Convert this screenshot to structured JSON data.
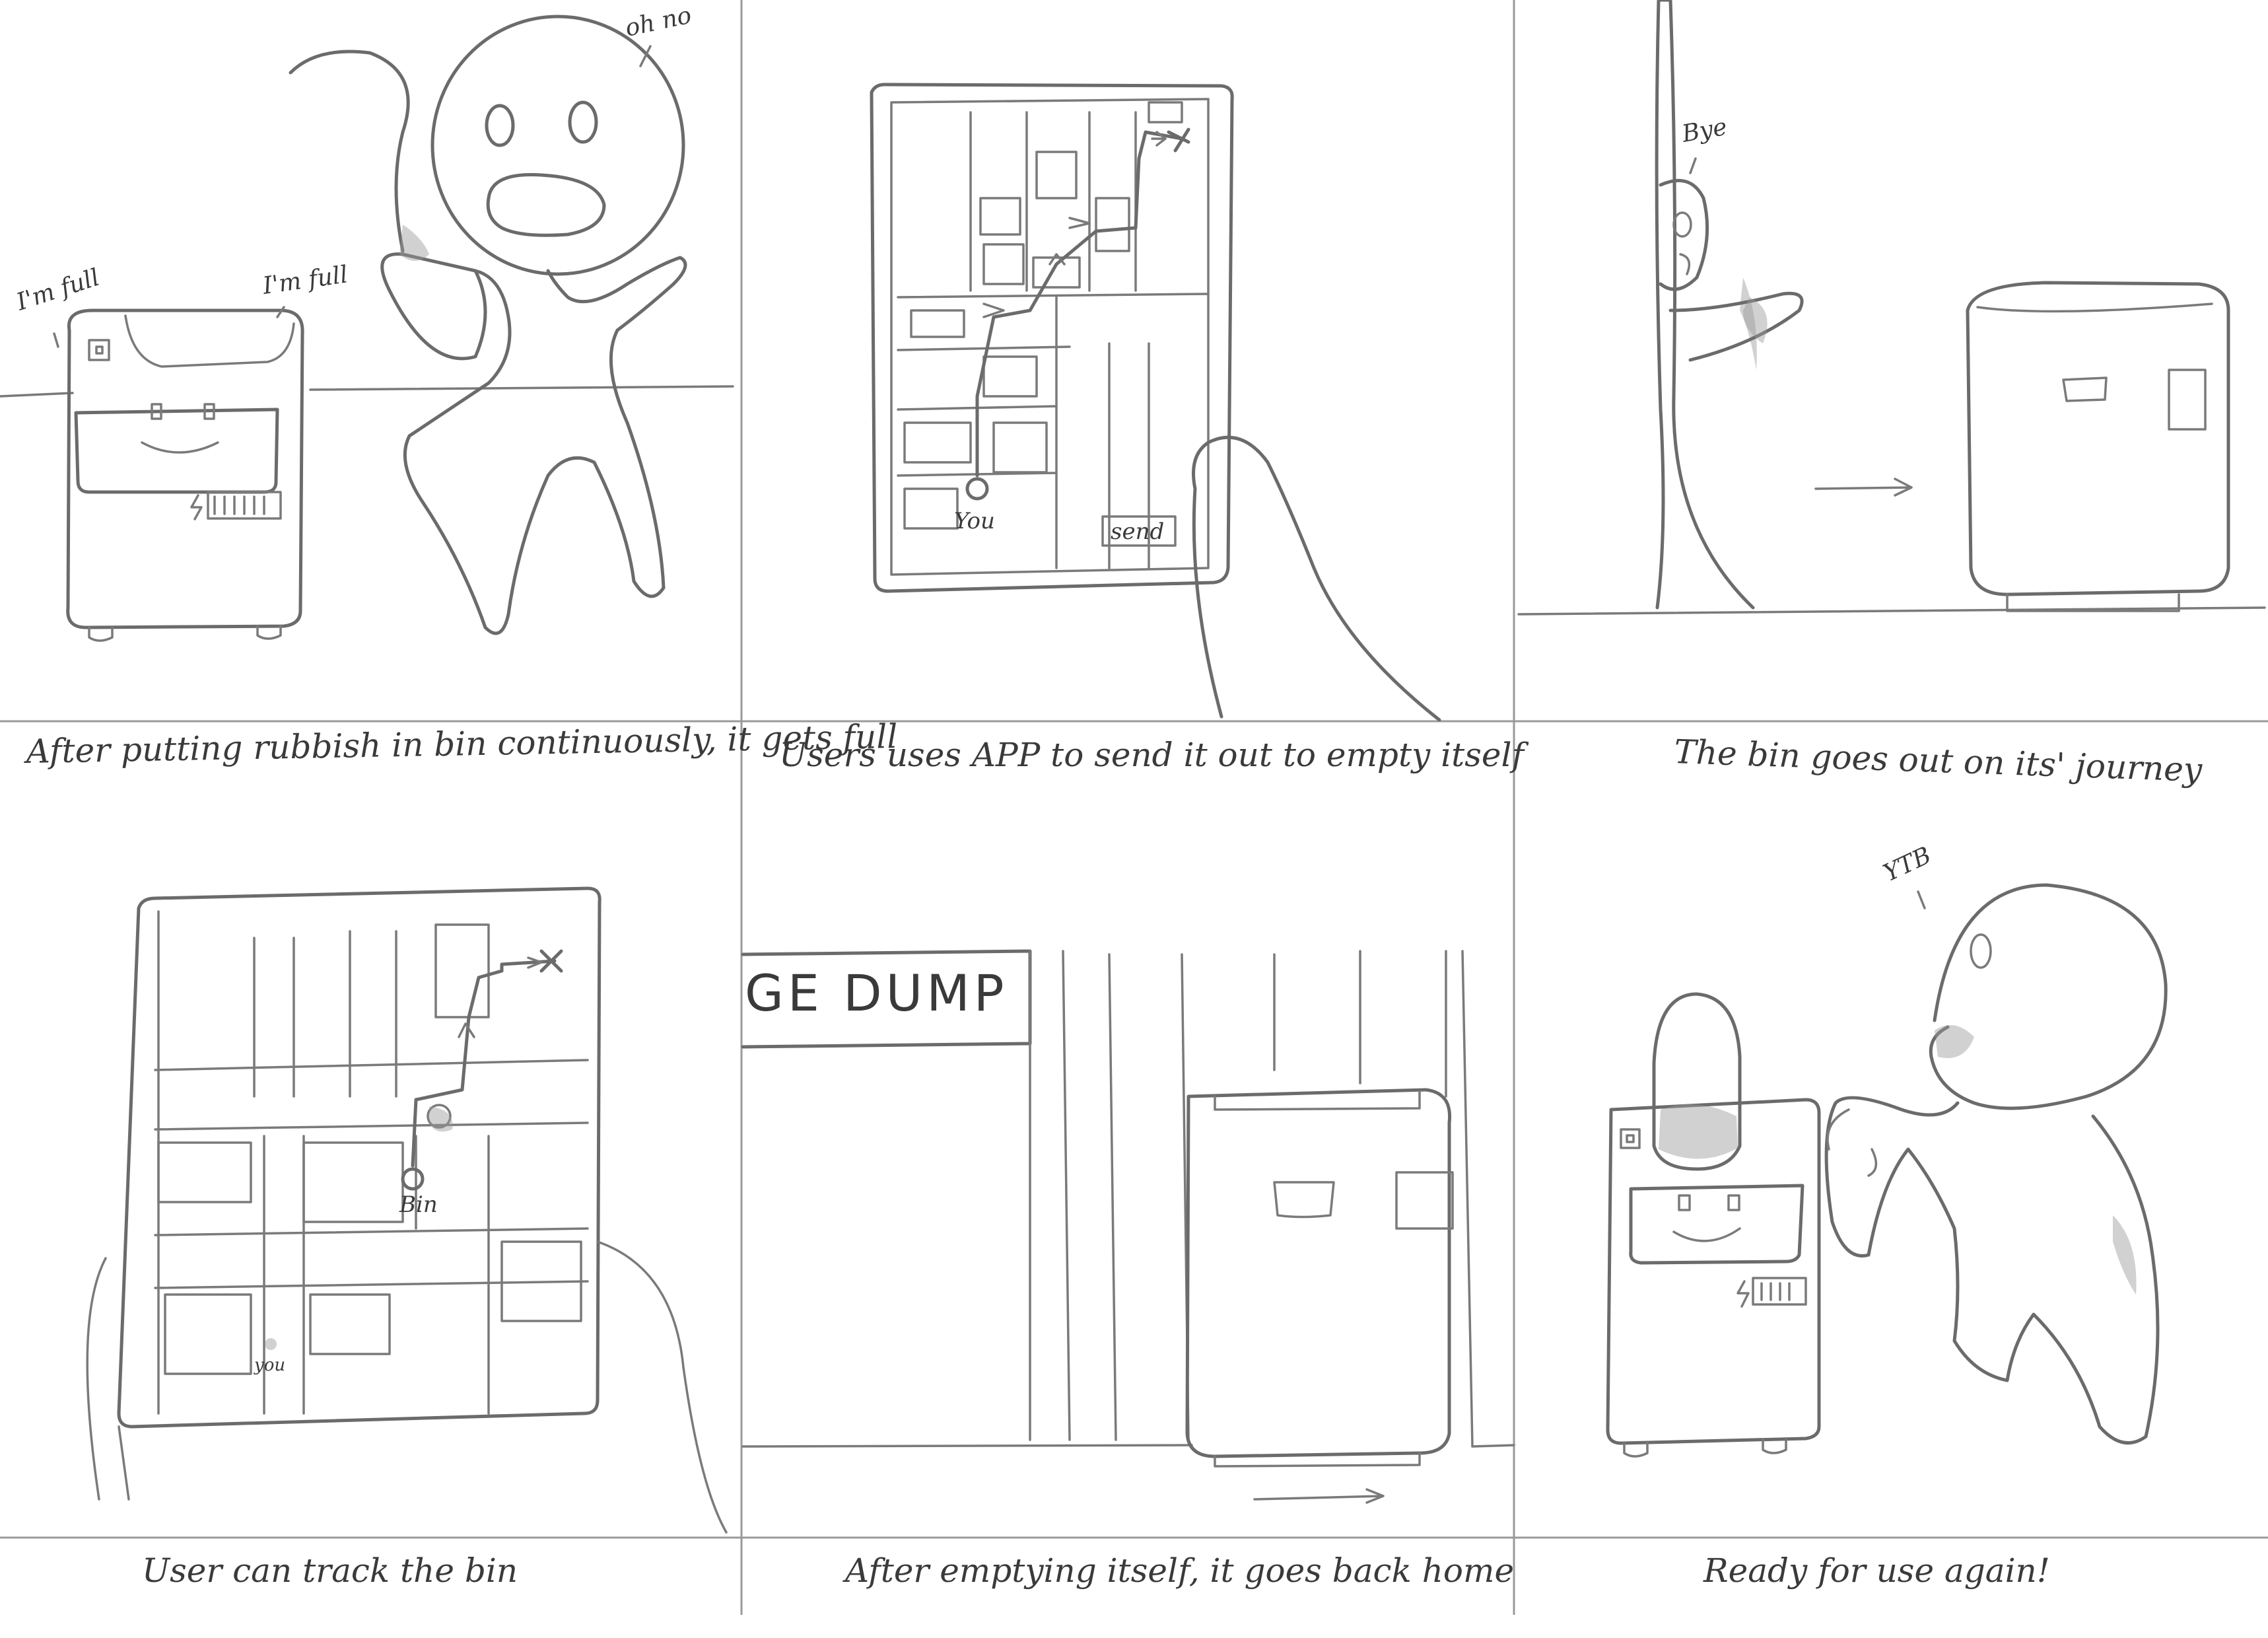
{
  "panels": [
    {
      "caption": "After putting rubbish in bin continuously, it gets full",
      "speech": [
        "I'm full",
        "I'm full",
        "oh no"
      ]
    },
    {
      "caption": "Users uses APP to send it out to empty itself",
      "map_labels": {
        "you": "You",
        "send": "send"
      }
    },
    {
      "caption": "The bin goes out on its' journey",
      "speech": [
        "Bye"
      ]
    },
    {
      "caption": "User can track the bin",
      "map_labels": {
        "bin": "Bin",
        "you": "you"
      }
    },
    {
      "caption": "After emptying itself, it goes back home",
      "sign": "GE DUMP"
    },
    {
      "caption": "Ready for use again!",
      "speech": [
        "YTB"
      ]
    }
  ]
}
